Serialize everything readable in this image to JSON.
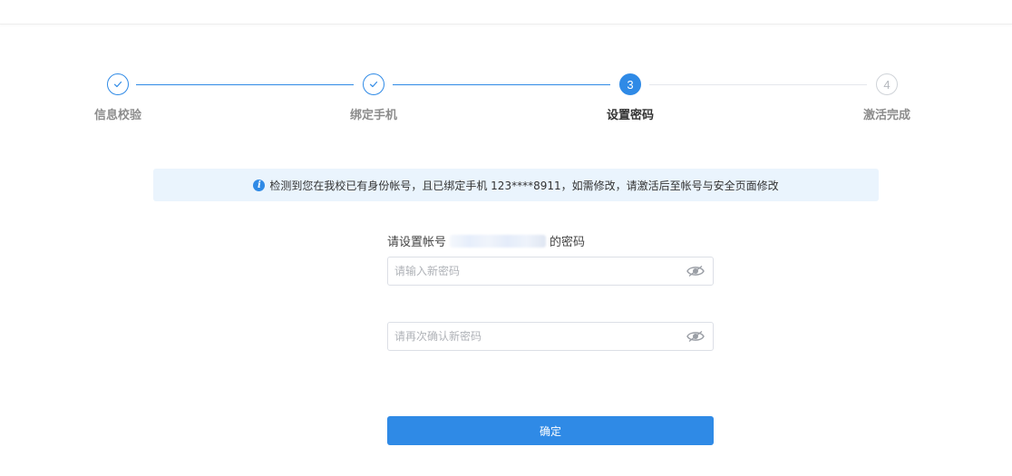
{
  "steps": [
    {
      "label": "信息校验",
      "number": "1",
      "state": "done"
    },
    {
      "label": "绑定手机",
      "number": "2",
      "state": "done"
    },
    {
      "label": "设置密码",
      "number": "3",
      "state": "current"
    },
    {
      "label": "激活完成",
      "number": "4",
      "state": "pending"
    }
  ],
  "alert": {
    "icon": "info-icon",
    "text": "检测到您在我校已有身份帐号，且已绑定手机 123****8911，如需修改，请激活后至帐号与安全页面修改"
  },
  "form": {
    "title_prefix": "请设置帐号",
    "title_suffix": "的密码",
    "password_placeholder": "请输入新密码",
    "confirm_placeholder": "请再次确认新密码",
    "submit_label": "确定"
  },
  "colors": {
    "accent": "#2f8ae6",
    "pending": "#cfd3d8",
    "alert_bg": "#eaf4fd"
  }
}
